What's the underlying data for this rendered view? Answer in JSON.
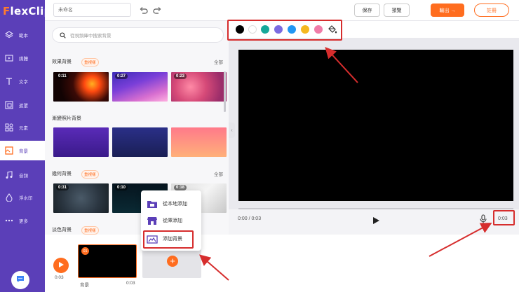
{
  "app": {
    "logo_f": "F",
    "logo_rest": "lexClip"
  },
  "sidebar": {
    "items": [
      {
        "label": "範本",
        "icon": "layers-icon"
      },
      {
        "label": "媒體",
        "icon": "media-icon"
      },
      {
        "label": "文字",
        "icon": "text-icon"
      },
      {
        "label": "遮罩",
        "icon": "mask-icon"
      },
      {
        "label": "元素",
        "icon": "elements-icon"
      },
      {
        "label": "背景",
        "icon": "background-icon"
      },
      {
        "label": "音頻",
        "icon": "music-icon"
      },
      {
        "label": "浮水印",
        "icon": "watermark-icon"
      },
      {
        "label": "更多",
        "icon": "more-icon"
      }
    ],
    "active_index": 5
  },
  "topbar": {
    "title_placeholder": "未命名",
    "save_label": "保存",
    "preview_label": "預覽",
    "export_label": "輸出 →",
    "login_label": "註冊"
  },
  "panel": {
    "search_placeholder": "從視頻庫中搜索背景",
    "see_all": "全部",
    "sections": [
      {
        "title": "效果背景",
        "badge": "重視樣",
        "durations": [
          "0:11",
          "0:27",
          "0:23"
        ]
      },
      {
        "title": "漸變照片背景",
        "badge": ""
      },
      {
        "title": "幾何背景",
        "badge": "重視樣",
        "durations": [
          "0:31",
          "0:10",
          "0:18"
        ]
      },
      {
        "title": "淡色背景",
        "badge": "重視樣"
      }
    ]
  },
  "popup": {
    "items": [
      {
        "label": "從本地添加",
        "icon": "local-folder-icon"
      },
      {
        "label": "從庫添加",
        "icon": "store-icon"
      },
      {
        "label": "添加背景",
        "icon": "add-background-icon"
      }
    ]
  },
  "timeline": {
    "time": "0:03",
    "clip_number": "01",
    "clip_label": "背景",
    "clip_duration": "0:03",
    "add_symbol": "+"
  },
  "player": {
    "time_current": "0:00 / 0:03",
    "time_total": "0:03"
  },
  "colors": {
    "accent": "#ff6d1f",
    "brand": "#5b3fb8",
    "swatches": [
      "#000000",
      "#ffffff",
      "#16a89a",
      "#7b6be0",
      "#2196f3",
      "#f5b820",
      "#f07ca8"
    ]
  }
}
